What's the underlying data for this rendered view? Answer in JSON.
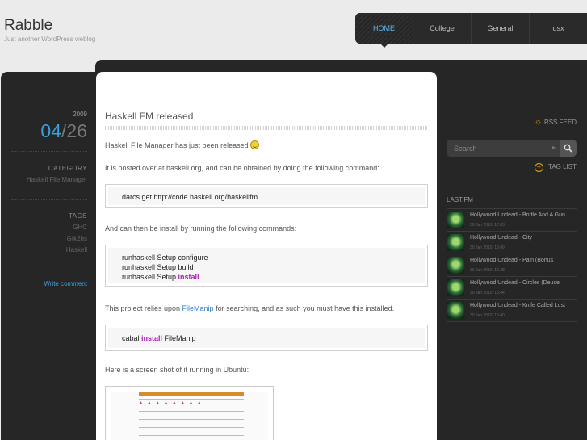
{
  "site": {
    "title": "Rabble",
    "tagline": "Just another WordPress weblog"
  },
  "nav": {
    "items": [
      {
        "label": "HOME",
        "active": true
      },
      {
        "label": "College",
        "active": false
      },
      {
        "label": "General",
        "active": false
      },
      {
        "label": "osx",
        "active": false
      }
    ]
  },
  "meta": {
    "year": "2009",
    "month": "04",
    "day": "26",
    "category_title": "CATEGORY",
    "category": "Haskell File Manager",
    "tags_title": "TAGS",
    "tags": [
      "GHC",
      "Gtk2hs",
      "Haskell"
    ],
    "write_comment": "Write comment"
  },
  "post": {
    "title": "Haskell FM released",
    "p1": "Haskell File Manager has just been released",
    "p2": "It is hosted over at haskell.org, and can be obtained by doing the following command:",
    "code1": "darcs get http://code.haskell.org/haskellfm",
    "p3": "And can then be install by running the following commands:",
    "code2": {
      "line1": "runhaskell Setup configure",
      "line2": "runhaskell Setup build",
      "line3_pre": "runhaskell Setup ",
      "line3_kw": "install"
    },
    "p4_pre": "This project relies upon ",
    "p4_link": "FileManip",
    "p4_post": " for searching, and as such you must have this installed.",
    "code3": {
      "pre": "cabal ",
      "kw": "install",
      "post": " FileManip"
    },
    "p5": "Here is a screen shot of it running in Ubuntu:"
  },
  "sidebar": {
    "rss": "RSS FEED",
    "search_placeholder": "Search",
    "tag_list": "TAG LIST",
    "lastfm_title": "LAST.FM",
    "tracks": [
      {
        "title": "Hollywood Undead - Bottle And A Gun",
        "date": "30 Jan 2010, 17:03"
      },
      {
        "title": "Hollywood Undead - City",
        "date": "30 Jan 2010, 16:49"
      },
      {
        "title": "Hollywood Undead - Pain (Bonus",
        "date": "30 Jan 2010, 16:48"
      },
      {
        "title": "Hollywood Undead - Circles (Deuce",
        "date": "30 Jan 2010, 16:44"
      },
      {
        "title": "Hollywood Undead - Knife Called Lust",
        "date": "30 Jan 2010, 16:40"
      }
    ]
  },
  "colors": {
    "accent": "#3aa0da",
    "keyword": "#b01dbb",
    "rss": "#e9a400"
  }
}
